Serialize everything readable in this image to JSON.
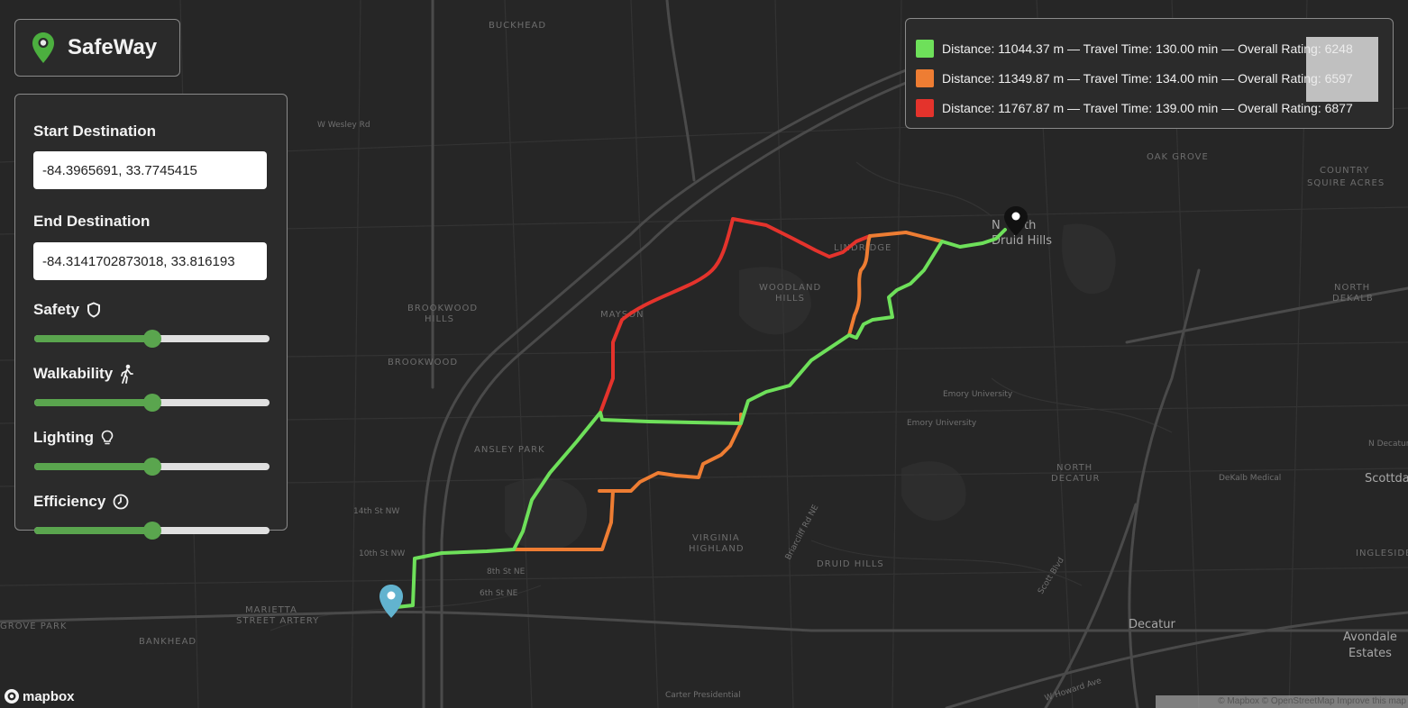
{
  "app": {
    "name": "SafeWay"
  },
  "controls": {
    "start_label": "Start Destination",
    "start_value": "-84.3965691, 33.7745415",
    "end_label": "End Destination",
    "end_value": "-84.3141702873018, 33.816193",
    "sliders": [
      {
        "label": "Safety",
        "icon": "shield-icon",
        "value": 0.5
      },
      {
        "label": "Walkability",
        "icon": "walking-person-icon",
        "value": 0.5
      },
      {
        "label": "Lighting",
        "icon": "lightbulb-icon",
        "value": 0.5
      },
      {
        "label": "Efficiency",
        "icon": "clock-icon",
        "value": 0.5
      }
    ]
  },
  "legend": {
    "routes": [
      {
        "color": "#6ee05a",
        "text": "Distance: 11044.37 m — Travel Time: 130.00 min — Overall Rating: 6248"
      },
      {
        "color": "#ee7d33",
        "text": "Distance: 11349.87 m — Travel Time: 134.00 min — Overall Rating: 6597"
      },
      {
        "color": "#e4332c",
        "text": "Distance: 11767.87 m — Travel Time: 139.00 min — Overall Rating: 6877"
      }
    ]
  },
  "map": {
    "start_marker_color": "#62b3cf",
    "end_marker_color": "#111111",
    "place_labels": [
      "BUCKHEAD",
      "W Wesley Rd",
      "BROOKWOOD HILLS",
      "BROOKWOOD",
      "ANSLEY PARK",
      "MAYSON",
      "WOODLAND HILLS",
      "LINDRIDGE",
      "Emory University",
      "Emory University",
      "NORTH DECATUR",
      "DeKalb Medical",
      "Scottdale",
      "N Decatur",
      "INGLESIDE",
      "Decatur",
      "Avondale Estates",
      "DRUID HILLS",
      "VIRGINIA HIGHLAND",
      "MARIETTA STREET ARTERY",
      "BANKHEAD",
      "14th St NW",
      "10th St NW",
      "8th St NE",
      "6th St NE",
      "N Druid Hills",
      "OAK GROVE",
      "COUNTRY SQUIRE ACRES",
      "NORTH DEKALB",
      "GROVE PARK",
      "Carter Presidential",
      "W Howard Ave",
      "Scott Blvd",
      "Briarcliff Rd NE"
    ],
    "attribution": "© Mapbox © OpenStreetMap Improve this map",
    "logo": "mapbox"
  }
}
